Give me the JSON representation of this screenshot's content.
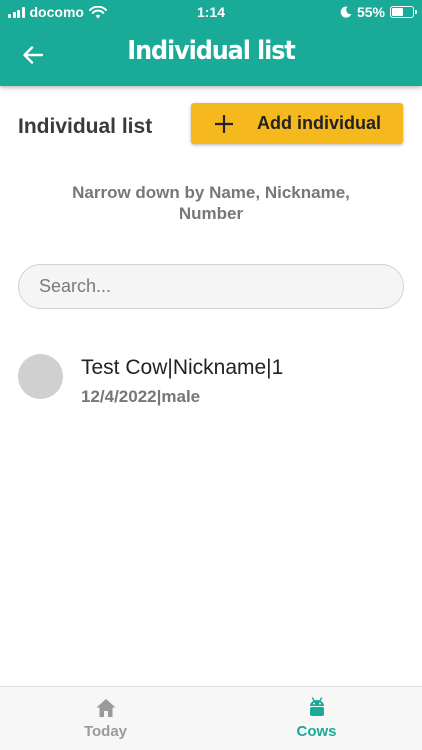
{
  "status_bar": {
    "carrier": "docomo",
    "time": "1:14",
    "battery_percent": "55%",
    "battery_level": 0.55
  },
  "header": {
    "title": "Individual list",
    "back_icon": "arrow-left-icon"
  },
  "main": {
    "section_heading": "Individual list",
    "add_button_label": "Add individual",
    "add_icon": "plus-icon",
    "hint": "Narrow down by Name, Nickname, Number",
    "search_placeholder": "Search...",
    "items": [
      {
        "title": "Test Cow|Nickname|1",
        "subtitle": "12/4/2022|male"
      }
    ]
  },
  "tabs": [
    {
      "label": "Today",
      "icon": "home-icon",
      "active": false
    },
    {
      "label": "Cows",
      "icon": "android-icon",
      "active": true
    }
  ],
  "colors": {
    "primary": "#1aaa98",
    "accent": "#f5b91e",
    "muted_text": "#777777",
    "inactive_tab": "#9a9a9a"
  }
}
